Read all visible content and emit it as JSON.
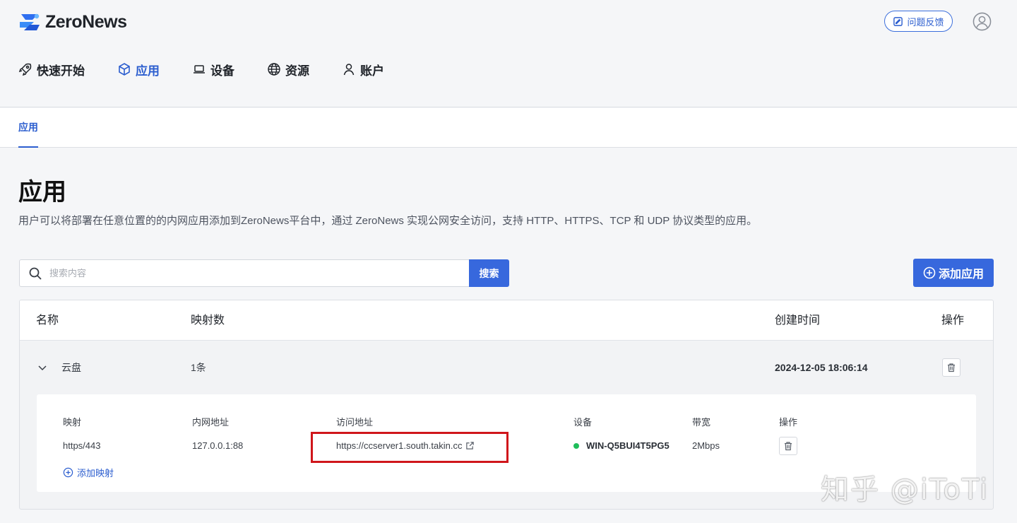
{
  "header": {
    "brand": "ZeroNews",
    "feedback_label": "问题反馈"
  },
  "nav": {
    "items": [
      {
        "label": "快速开始",
        "icon": "rocket-icon",
        "active": false
      },
      {
        "label": "应用",
        "icon": "cube-icon",
        "active": true
      },
      {
        "label": "设备",
        "icon": "laptop-icon",
        "active": false
      },
      {
        "label": "资源",
        "icon": "globe-icon",
        "active": false
      },
      {
        "label": "账户",
        "icon": "user-icon",
        "active": false
      }
    ]
  },
  "subtab": {
    "label": "应用"
  },
  "page": {
    "title": "应用",
    "description": "用户可以将部署在任意位置的的内网应用添加到ZeroNews平台中，通过 ZeroNews 实现公网安全访问，支持 HTTP、HTTPS、TCP 和 UDP 协议类型的应用。"
  },
  "search": {
    "placeholder": "搜索内容",
    "button_label": "搜索"
  },
  "add_app": {
    "label": "添加应用"
  },
  "table": {
    "headers": {
      "name": "名称",
      "mapping_count": "映射数",
      "created_at": "创建时间",
      "actions": "操作"
    },
    "rows": [
      {
        "name": "云盘",
        "mapping_count": "1条",
        "created_at": "2024-12-05 18:06:14",
        "expanded": true
      }
    ]
  },
  "mappings": {
    "headers": {
      "mapping": "映射",
      "intranet_address": "内网地址",
      "access_address": "访问地址",
      "device": "设备",
      "bandwidth": "带宽",
      "actions": "操作"
    },
    "rows": [
      {
        "mapping": "https/443",
        "intranet_address": "127.0.0.1:88",
        "access_address": "https://ccserver1.south.takin.cc",
        "device": "WIN-Q5BUI4T5PG5",
        "device_status_color": "#1fbd5a",
        "bandwidth": "2Mbps"
      }
    ],
    "add_label": "添加映射"
  },
  "watermark": "知乎 @iToTi",
  "colors": {
    "accent": "#3768dd",
    "highlight": "#d0161b",
    "online": "#1fbd5a"
  }
}
